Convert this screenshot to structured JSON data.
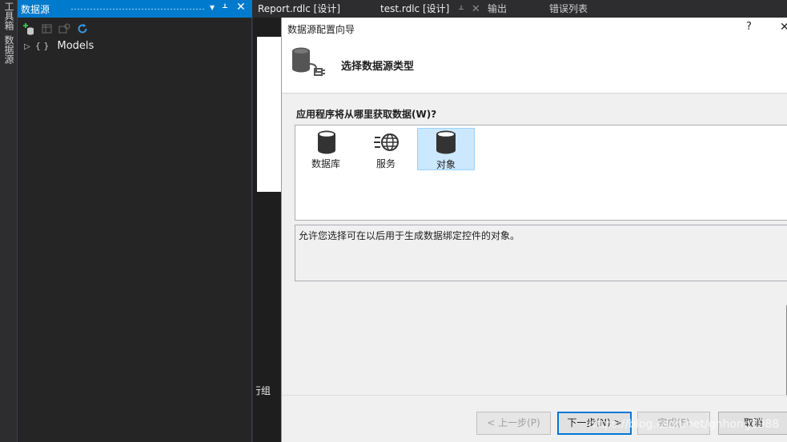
{
  "left_strip": {
    "tab1": "工具箱",
    "tab2": "数据源"
  },
  "datasource_panel": {
    "title": "数据源",
    "pin_icon": "pin-icon",
    "tree": {
      "expander": "▷",
      "braces": "{ }",
      "label": "Models"
    }
  },
  "tabs": [
    {
      "label": "Report.rdlc [设计]"
    },
    {
      "label": "test.rdlc [设计]"
    },
    {
      "label": "输出"
    },
    {
      "label": "错误列表"
    }
  ],
  "editor": {
    "fragment": "行组"
  },
  "dialog": {
    "title": "数据源配置向导",
    "help": "?",
    "close": "✕",
    "heading": "选择数据源类型",
    "question": "应用程序将从哪里获取数据(W)?",
    "types": [
      {
        "label": "数据库",
        "icon": "database-icon"
      },
      {
        "label": "服务",
        "icon": "service-globe-icon"
      },
      {
        "label": "对象",
        "icon": "object-icon",
        "selected": true
      }
    ],
    "description": "允许您选择可在以后用于生成数据绑定控件的对象。",
    "buttons": {
      "prev": "< 上一步(P)",
      "next": "下一步(N) >",
      "finish": "完成(F)",
      "cancel": "取消"
    },
    "watermark": "https://blog.csdn.net/gnhong1988"
  },
  "colors": {
    "accent": "#007acc",
    "selection": "#cce8ff",
    "ide_bg": "#2d2d30"
  }
}
